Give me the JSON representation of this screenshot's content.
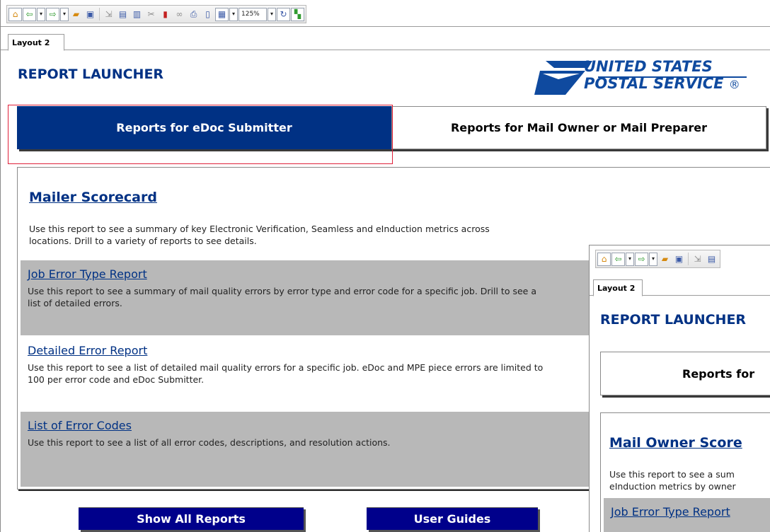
{
  "toolbar": {
    "zoom": "125%",
    "icons": [
      "home-icon",
      "back-icon",
      "forward-icon",
      "open-folder-icon",
      "save-icon",
      "export-icon",
      "print-icon",
      "refresh-icon",
      "layout-icon"
    ]
  },
  "tabs": {
    "layout_label": "Layout 2"
  },
  "header": {
    "title": "REPORT LAUNCHER",
    "logo_line1": "UNITED STATES",
    "logo_line2": "POSTAL SERVICE",
    "logo_reg": "®"
  },
  "nav": {
    "active_label": "Reports for eDoc Submitter",
    "inactive_label": "Reports for Mail Owner or Mail Preparer"
  },
  "panel": {
    "title": "Mailer Scorecard",
    "description": "Use this report to see a summary of key Electronic Verification, Seamless and eInduction metrics across locations. Drill to a variety of reports to see details.",
    "reports": [
      {
        "label": "Job Error Type Report",
        "description": "Use this report to see a summary of mail quality errors by error type and error code for a specific job. Drill to see a list of detailed errors."
      },
      {
        "label": "Detailed Error Report",
        "description": "Use this report to see a list of detailed mail quality errors for a specific job. eDoc and MPE piece errors are limited to 100 per error code and eDoc Submitter."
      },
      {
        "label": "List of Error Codes",
        "description": "Use this report to see a list of all error codes, descriptions, and resolution actions."
      }
    ]
  },
  "buttons": {
    "show_all": "Show All Reports",
    "user_guides": "User Guides"
  },
  "inset": {
    "tab_label": "Layout 2",
    "title": "REPORT LAUNCHER",
    "nav_label": "Reports for",
    "panel_title": "Mail Owner Score",
    "panel_desc_line1": "Use this report to see a sum",
    "panel_desc_line2": "eInduction metrics by owner",
    "row_label": "Job Error Type Report"
  },
  "colors": {
    "brand_blue": "#003184",
    "button_navy": "#00008b",
    "row_grey": "#b8b8b8",
    "focus_red": "#e0203a"
  }
}
